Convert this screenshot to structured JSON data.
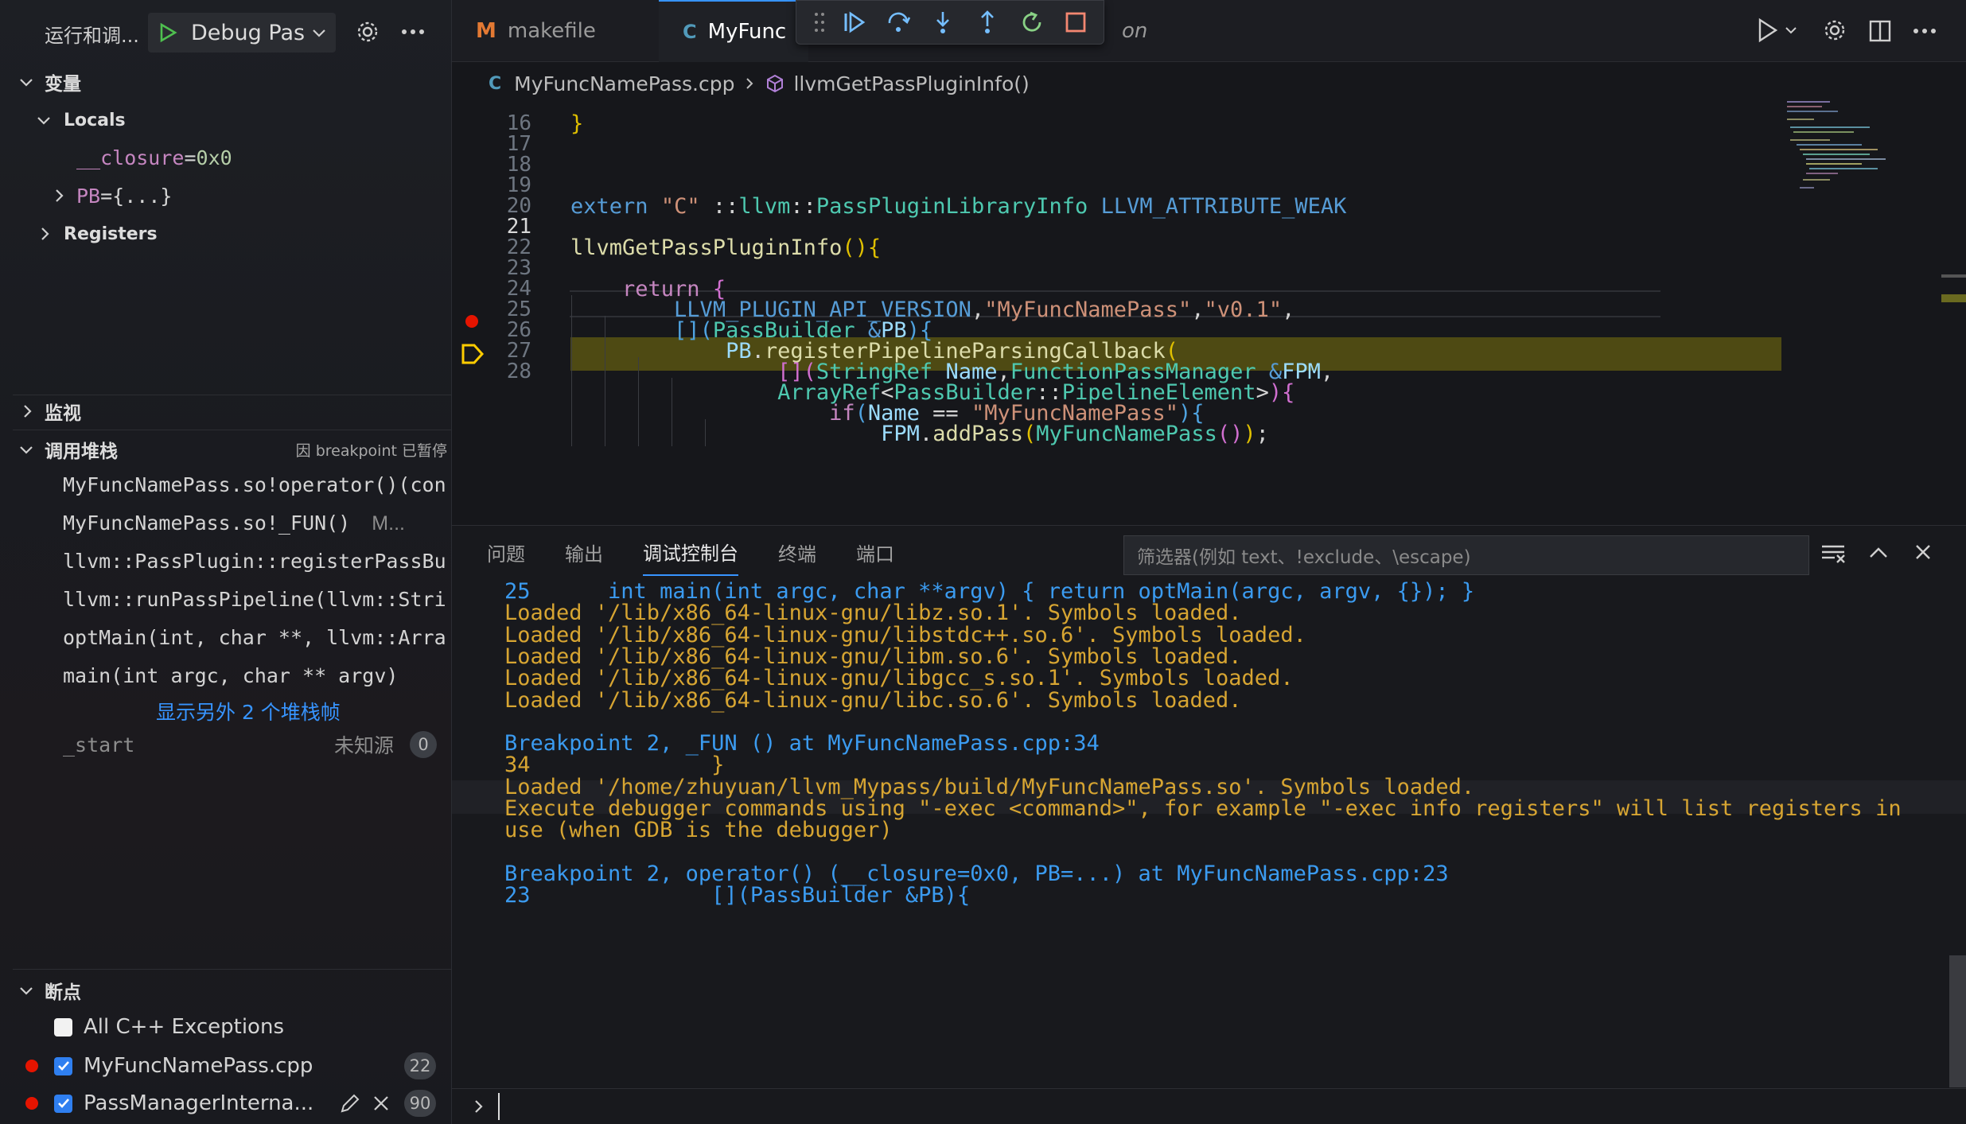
{
  "sidebar": {
    "run_title": "运行和调...",
    "debug_config": "Debug Pas",
    "variables_header": "变量",
    "locals_label": "Locals",
    "locals": [
      {
        "name": "__closure",
        "sep": " = ",
        "value": "0x0"
      },
      {
        "name": "PB",
        "sep": " = ",
        "value": "{...}"
      }
    ],
    "registers_label": "Registers",
    "watch_header": "监视",
    "callstack_header": "调用堆栈",
    "callstack_status": "因 breakpoint 已暂停",
    "frames": [
      {
        "label": "MyFuncNamePass.so!operator()(con",
        "extra": ""
      },
      {
        "label": "MyFuncNamePass.so!_FUN()",
        "extra": "M..."
      },
      {
        "label": "llvm::PassPlugin::registerPassBu",
        "extra": ""
      },
      {
        "label": "llvm::runPassPipeline(llvm::Stri",
        "extra": ""
      },
      {
        "label": "optMain(int, char **, llvm::Arra",
        "extra": ""
      },
      {
        "label": "main(int argc, char ** argv)",
        "extra": ""
      }
    ],
    "show_more": "显示另外 2 个堆栈帧",
    "start_frame": "_start",
    "unknown_source": "未知源",
    "start_badge": "0",
    "breakpoints_header": "断点",
    "breakpoints": [
      {
        "label": "All C++ Exceptions",
        "checked": false,
        "badge": ""
      },
      {
        "label": "MyFuncNamePass.cpp",
        "checked": true,
        "badge": "22"
      },
      {
        "label": "PassManagerInterna...",
        "checked": true,
        "badge": "90"
      }
    ]
  },
  "tabs": [
    {
      "label": "makefile",
      "icon": "M"
    },
    {
      "label": "MyFunc",
      "icon": "C"
    },
    {
      "label": "on",
      "icon": ""
    }
  ],
  "breadcrumb": {
    "file": "MyFuncNamePass.cpp",
    "symbol": "llvmGetPassPluginInfo()"
  },
  "code": {
    "line_numbers": [
      "16",
      "17",
      "18",
      "19",
      "20",
      "21",
      "22",
      "23",
      "24",
      "25",
      "26",
      "27",
      "28"
    ],
    "current_line": "21",
    "breakpoint_line": "22",
    "paused_line": "23"
  },
  "panel": {
    "tabs": [
      "问题",
      "输出",
      "调试控制台",
      "终端",
      "端口"
    ],
    "active_tab": "调试控制台",
    "filter_placeholder": "筛选器(例如 text、!exclude、\\escape)",
    "output": [
      {
        "text": "25      int main(int argc, char **argv) { return optMain(argc, argv, {}); }",
        "color": "blue"
      },
      {
        "text": "Loaded '/lib/x86_64-linux-gnu/libz.so.1'. Symbols loaded.",
        "color": "yellow"
      },
      {
        "text": "Loaded '/lib/x86_64-linux-gnu/libstdc++.so.6'. Symbols loaded.",
        "color": "yellow"
      },
      {
        "text": "Loaded '/lib/x86_64-linux-gnu/libm.so.6'. Symbols loaded.",
        "color": "yellow"
      },
      {
        "text": "Loaded '/lib/x86_64-linux-gnu/libgcc_s.so.1'. Symbols loaded.",
        "color": "yellow"
      },
      {
        "text": "Loaded '/lib/x86_64-linux-gnu/libc.so.6'. Symbols loaded.",
        "color": "yellow"
      },
      {
        "text": "",
        "color": "yellow"
      },
      {
        "text": "Breakpoint 2, _FUN () at MyFuncNamePass.cpp:34",
        "color": "blue"
      },
      {
        "text": "34              }",
        "color": "yellow"
      },
      {
        "text": "Loaded '/home/zhuyuan/llvm_Mypass/build/MyFuncNamePass.so'. Symbols loaded.",
        "color": "yellow"
      },
      {
        "text": "Execute debugger commands using \"-exec <command>\", for example \"-exec info registers\" will list registers in",
        "color": "yellow"
      },
      {
        "text": "use (when GDB is the debugger)",
        "color": "yellow"
      },
      {
        "text": "",
        "color": "yellow"
      },
      {
        "text": "Breakpoint 2, operator() (__closure=0x0, PB=...) at MyFuncNamePass.cpp:23",
        "color": "blue"
      },
      {
        "text": "23              [](PassBuilder &PB){",
        "color": "blue"
      }
    ],
    "prompt": ">"
  },
  "colors": {
    "accent": "#3794ff",
    "breakpoint": "#e51400",
    "paused_highlight": "#4e4a13"
  }
}
